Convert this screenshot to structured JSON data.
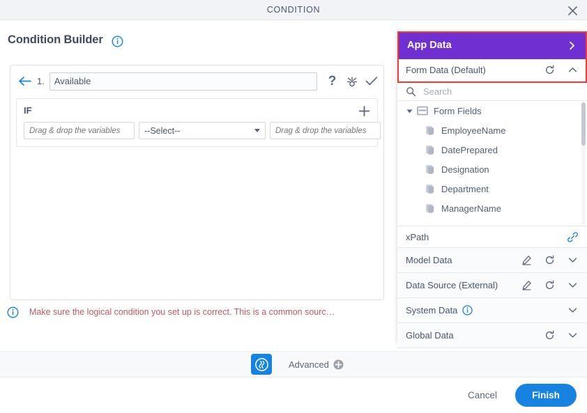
{
  "window": {
    "title": "CONDITION",
    "close_icon": "close-icon"
  },
  "left": {
    "heading": "Condition Builder",
    "heading_info_icon": "info-icon",
    "condition": {
      "back_icon": "back-arrow-icon",
      "number": "1.",
      "name_value": "Available",
      "name_placeholder": "",
      "icons": {
        "help": "?",
        "help_name": "help-icon",
        "test_name": "test-condition-icon",
        "apply_name": "check-icon"
      }
    },
    "if_block": {
      "label": "IF",
      "add_icon": "plus-icon",
      "lhs_placeholder": "Drag & drop the variables",
      "lhs_value": "",
      "operator_value": "--Select--",
      "operator_options": [
        "--Select--"
      ],
      "rhs_placeholder": "Drag & drop the variables",
      "rhs_value": ""
    },
    "warning": {
      "icon": "info-icon",
      "text": "Make sure the logical condition you set up is correct. This is a common sourc…"
    }
  },
  "right": {
    "app_data": {
      "label": "App Data",
      "chevron_icon": "chevron-right-icon",
      "bg_color": "#7030d1"
    },
    "form_data": {
      "label": "Form Data (Default)",
      "refresh_icon": "refresh-icon",
      "chevron_icon": "chevron-up-icon"
    },
    "highlight_color": "#ef3e36",
    "search": {
      "icon": "search-icon",
      "placeholder": "Search",
      "value": ""
    },
    "tree": {
      "root": {
        "label": "Form Fields",
        "caret_icon": "caret-down-icon",
        "icon": "form-icon"
      },
      "children": [
        {
          "label": "EmployeeName",
          "icon": "field-icon"
        },
        {
          "label": "DatePrepared",
          "icon": "field-icon"
        },
        {
          "label": "Designation",
          "icon": "field-icon"
        },
        {
          "label": "Department",
          "icon": "field-icon"
        },
        {
          "label": "ManagerName",
          "icon": "field-icon"
        }
      ]
    },
    "xpath": {
      "label": "xPath",
      "icon": "link-icon"
    },
    "sections": [
      {
        "label": "Model Data",
        "edit_icon": "edit-icon",
        "refresh_icon": "refresh-icon",
        "chevron_icon": "chevron-down-icon",
        "has_edit": true,
        "has_refresh": true,
        "has_info": false
      },
      {
        "label": "Data Source (External)",
        "edit_icon": "edit-icon",
        "refresh_icon": "refresh-icon",
        "chevron_icon": "chevron-down-icon",
        "has_edit": true,
        "has_refresh": true,
        "has_info": false
      },
      {
        "label": "System Data",
        "info_icon": "info-icon",
        "chevron_icon": "chevron-down-icon",
        "has_edit": false,
        "has_refresh": false,
        "has_info": true
      },
      {
        "label": "Global Data",
        "refresh_icon": "refresh-icon",
        "chevron_icon": "chevron-down-icon",
        "has_edit": false,
        "has_refresh": true,
        "has_info": false
      }
    ]
  },
  "advanced": {
    "badge_icon": "advanced-mode-icon",
    "label": "Advanced",
    "plus_icon": "plus-circle-icon",
    "badge_color": "#1683e0"
  },
  "footer": {
    "cancel_label": "Cancel",
    "finish_label": "Finish",
    "primary_color": "#1683e0"
  }
}
